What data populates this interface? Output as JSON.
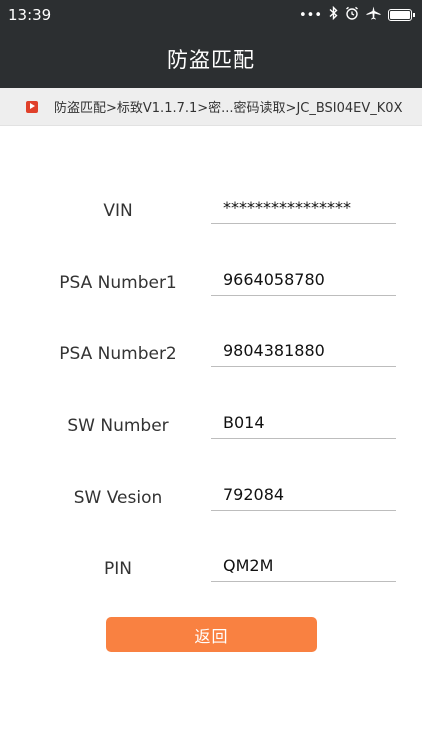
{
  "status_bar": {
    "time": "13:39",
    "icons": [
      "dots-icon",
      "bluetooth-icon",
      "alarm-icon",
      "airplane-icon",
      "battery-icon"
    ]
  },
  "app_bar": {
    "title": "防盗匹配"
  },
  "breadcrumb": {
    "text": "防盗匹配>标致V1.1.7.1>密...密码读取>JC_BSI04EV_K0X"
  },
  "fields": [
    {
      "label": "VIN",
      "value": "****************"
    },
    {
      "label": "PSA Number1",
      "value": "9664058780"
    },
    {
      "label": "PSA Number2",
      "value": "9804381880"
    },
    {
      "label": "SW Number",
      "value": "B014"
    },
    {
      "label": "SW Vesion",
      "value": "792084"
    },
    {
      "label": "PIN",
      "value": "QM2M"
    }
  ],
  "actions": {
    "back_label": "返回"
  },
  "colors": {
    "header_bg": "#2c2f31",
    "accent": "#f98141",
    "breadcrumb_bg": "#eeeeee"
  }
}
